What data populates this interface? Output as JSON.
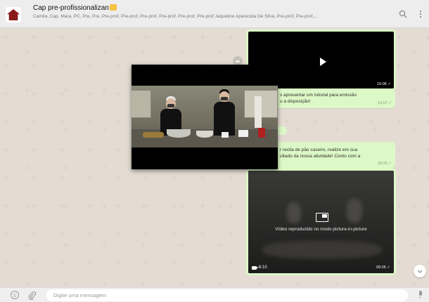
{
  "header": {
    "title": "Cap pre-profissionalizan",
    "participants": "Camila, Cap, Mara, PC, Pre, Pre, Pre-prof, Pre-prof, Pre-prof, Pre-prof, Pre-prof, Pre-prof Jaqueline Aparecida De Silva, Pre-prof, Pre-prof,...",
    "search_icon": "search-icon",
    "menu_icon": "more-options-icon"
  },
  "messages": {
    "video1_time": "10:06 ✓",
    "text1_line1": "s apresentar um tutorial para emissão",
    "text1_line2": "u a disposição!",
    "text1_time": "13:07 ✓",
    "text2_line1": "r recita de pão caseiro, realize em sua",
    "text2_line2": "ultado da nossa atividade! Conto com a",
    "text2_time": "09:25 ✓",
    "video2_duration": "6:10",
    "video2_time": "09:26 ✓",
    "video2_pip_text": "Vídeo reproduzido no modo picture-in-picture"
  },
  "footer": {
    "input_placeholder": "Digite uma mensagem"
  },
  "colors": {
    "bubble_out": "#dcf8c6",
    "wallpaper": "#e5ddd5",
    "header_bg": "#ededed"
  }
}
